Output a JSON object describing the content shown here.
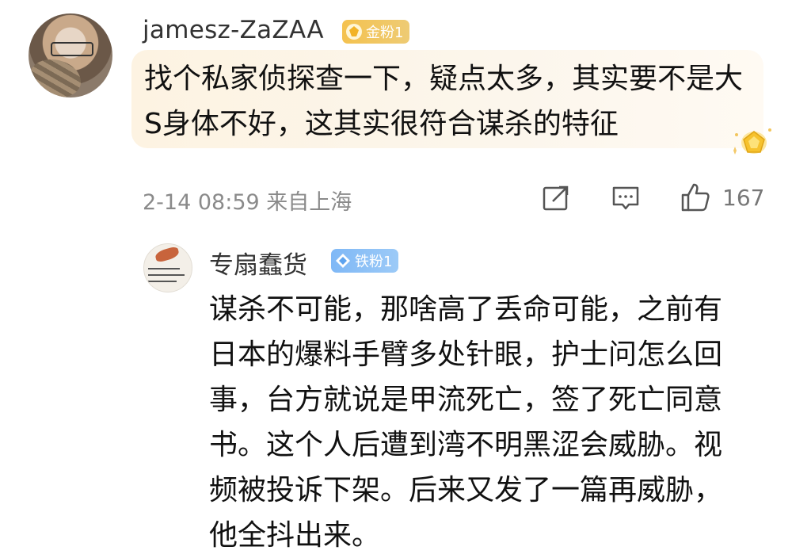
{
  "comment": {
    "username": "jamesz-ZaZAA",
    "badge": "金粉1",
    "text": "找个私家侦探查一下，疑点太多，其实要不是大S身体不好，这其实很符合谋杀的特征",
    "time": "2-14 08:59",
    "location": "来自上海",
    "likes": "167",
    "icons": [
      "share-icon",
      "comment-icon",
      "like-icon",
      "crown-icon"
    ]
  },
  "reply": {
    "username": "专扇蠢货",
    "badge": "铁粉1",
    "text": "谋杀不可能，那啥高了丢命可能，之前有日本的爆料手臂多处针眼，护士问怎么回事，台方就说是甲流死亡，签了死亡同意书。这个人后遭到湾不明黑涩会威胁。视频被投诉下架。后来又发了一篇再威胁，他全抖出来。"
  },
  "colors": {
    "gold_badge": "#f4c24f",
    "iron_badge": "#7fb8f6",
    "bubble": "#fdf3e2",
    "meta_text": "#8a8a8a"
  }
}
